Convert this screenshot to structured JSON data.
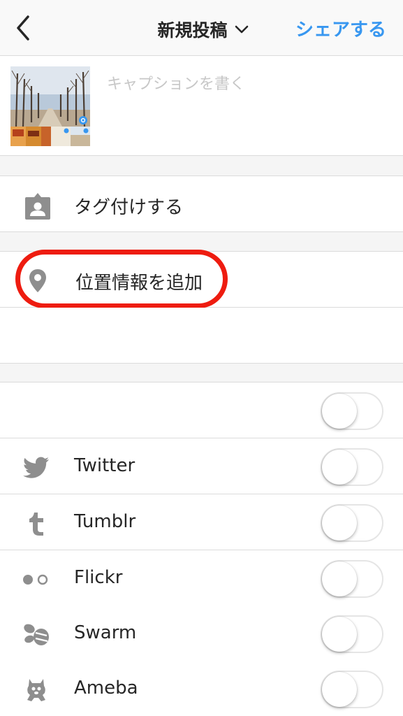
{
  "nav": {
    "back_icon": "chevron-left-icon",
    "title": "新規投稿",
    "title_dropdown_icon": "chevron-down-icon",
    "share": "シェアする"
  },
  "caption": {
    "placeholder": "キャプションを書く"
  },
  "options": {
    "tag_people": "タグ付けする",
    "add_location": "位置情報を追加"
  },
  "share_services": [
    {
      "label": "",
      "enabled": false
    },
    {
      "label": "Twitter",
      "icon": "twitter-icon",
      "enabled": false
    },
    {
      "label": "Tumblr",
      "icon": "tumblr-icon",
      "enabled": false
    },
    {
      "label": "Flickr",
      "icon": "flickr-icon",
      "enabled": false
    },
    {
      "label": "Swarm",
      "icon": "swarm-icon",
      "enabled": false
    },
    {
      "label": "Ameba",
      "icon": "ameba-icon",
      "enabled": false
    }
  ],
  "colors": {
    "accent": "#3897f0",
    "highlight": "#ee1c10",
    "icon_gray": "#8e8e8e"
  }
}
